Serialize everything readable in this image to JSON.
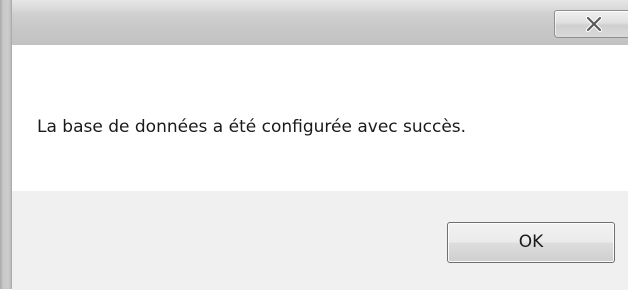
{
  "window": {
    "title": "",
    "close_icon": "close-x-icon"
  },
  "dialog": {
    "message": "La base de données a été configurée avec succès.",
    "ok_label": "OK"
  },
  "colors": {
    "titlebar": "#c8c8c8",
    "client_bg": "#ffffff",
    "button_bar_bg": "#f0f0f0",
    "text": "#1a1a1a"
  }
}
